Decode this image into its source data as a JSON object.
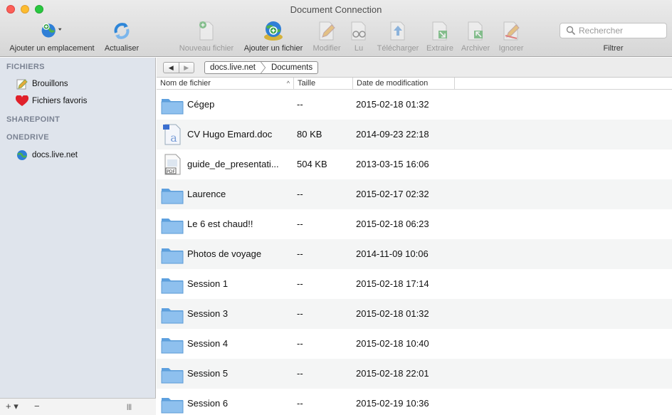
{
  "window": {
    "title": "Document Connection"
  },
  "toolbar": {
    "add_location": "Ajouter un emplacement",
    "refresh": "Actualiser",
    "new_file": "Nouveau fichier",
    "add_file": "Ajouter un fichier",
    "edit": "Modifier",
    "read": "Lu",
    "download": "Télécharger",
    "extract": "Extraire",
    "archive": "Archiver",
    "ignore": "Ignorer",
    "search_placeholder": "Rechercher",
    "filter": "Filtrer"
  },
  "sidebar": {
    "files_header": "FICHIERS",
    "drafts": "Brouillons",
    "favorites": "Fichiers favoris",
    "sharepoint_header": "SHAREPOINT",
    "onedrive_header": "ONEDRIVE",
    "onedrive_item": "docs.live.net",
    "footer_add": "+ ▾",
    "footer_remove": "−",
    "footer_handle": "|||"
  },
  "pathbar": {
    "back": "◀",
    "forward": "▶",
    "crumbs": [
      "docs.live.net",
      "Documents"
    ]
  },
  "columns": {
    "name": "Nom de fichier",
    "size": "Taille",
    "modified": "Date de modification",
    "sort_glyph": "^"
  },
  "files": [
    {
      "type": "folder",
      "name": "Cégep",
      "size": "--",
      "modified": "2015-02-18 01:32"
    },
    {
      "type": "doc",
      "name": "CV Hugo Emard.doc",
      "size": "80 KB",
      "modified": "2014-09-23 22:18"
    },
    {
      "type": "pdf",
      "name": "guide_de_presentati...",
      "size": "504 KB",
      "modified": "2013-03-15 16:06"
    },
    {
      "type": "folder",
      "name": "Laurence",
      "size": "--",
      "modified": "2015-02-17 02:32"
    },
    {
      "type": "folder",
      "name": "Le 6 est chaud!!",
      "size": "--",
      "modified": "2015-02-18 06:23"
    },
    {
      "type": "folder",
      "name": "Photos de voyage",
      "size": "--",
      "modified": "2014-11-09 10:06"
    },
    {
      "type": "folder",
      "name": "Session 1",
      "size": "--",
      "modified": "2015-02-18 17:14"
    },
    {
      "type": "folder",
      "name": "Session 3",
      "size": "--",
      "modified": "2015-02-18 01:32"
    },
    {
      "type": "folder",
      "name": "Session 4",
      "size": "--",
      "modified": "2015-02-18 10:40"
    },
    {
      "type": "folder",
      "name": "Session 5",
      "size": "--",
      "modified": "2015-02-18 22:01"
    },
    {
      "type": "folder",
      "name": "Session 6",
      "size": "--",
      "modified": "2015-02-19 10:36"
    }
  ],
  "colors": {
    "sidebar_bg": "#dfe4ec",
    "folder_blue": "#7eb6ea",
    "row_alt": "#f4f5f5"
  }
}
